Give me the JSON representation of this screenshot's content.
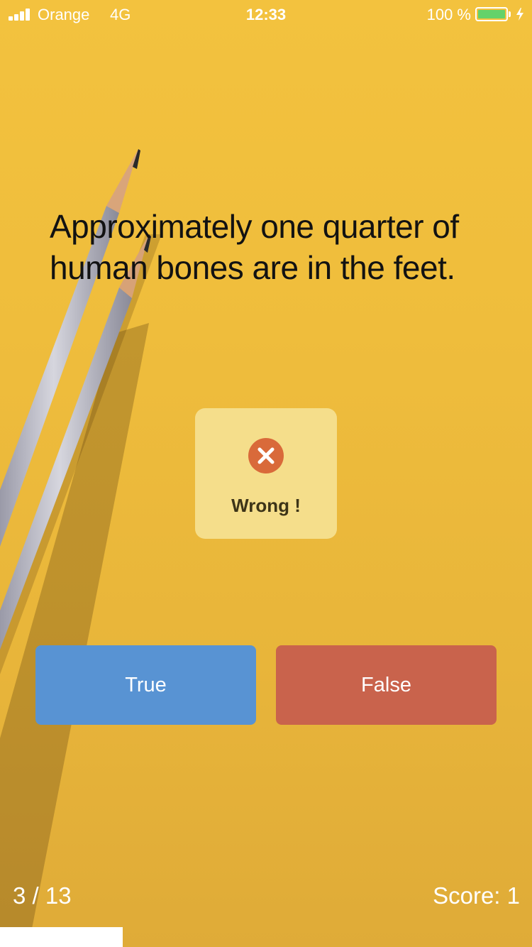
{
  "status_bar": {
    "carrier": "Orange",
    "network": "4G",
    "time": "12:33",
    "battery_percent": "100 %",
    "icons": [
      "signal-icon",
      "battery-icon",
      "charging-bolt-icon"
    ],
    "battery_color": "#64d26a"
  },
  "question": {
    "text": "Approximately one quarter of human bones are in the feet."
  },
  "feedback": {
    "icon": "close-circle-icon",
    "label": "Wrong !",
    "icon_color": "#d96a3a"
  },
  "answers": {
    "true_label": "True",
    "false_label": "False",
    "true_color": "#5893d3",
    "false_color": "#c9634c"
  },
  "footer": {
    "progress_label": "3 / 13",
    "score_label": "Score: 1",
    "progress_fraction": 0.2308
  },
  "theme": {
    "background": "#efbd3c",
    "text_light": "#ffffff"
  }
}
